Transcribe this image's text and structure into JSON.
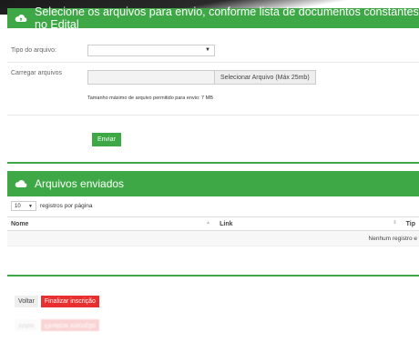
{
  "upload_panel": {
    "title": "Selecione os arquivos para envio, conforme lista de documentos constantes no Edital",
    "icon": "cloud-upload-icon",
    "doc_type_label": "Tipo do arquivo:",
    "doc_type_value": "",
    "upload_label": "Carregar arquivos",
    "upload_button": "Selecionar Arquivo (Máx 25mb)",
    "max_size_hint": "Tamanho máximo de arquivo permitido para envio: 7 MB",
    "send_button": "Enviar"
  },
  "sent_panel": {
    "title": "Arquivos enviados",
    "icon": "cloud-icon",
    "page_length": "10",
    "page_length_label": "registros por página",
    "columns": [
      "Nome",
      "Link",
      "Tip"
    ],
    "empty_message": "Nenhum registro e"
  },
  "actions": {
    "back": "Voltar",
    "finish": "Finalizar inscrição"
  },
  "colors": {
    "accent_green": "#3da845",
    "danger_red": "#e83030"
  }
}
